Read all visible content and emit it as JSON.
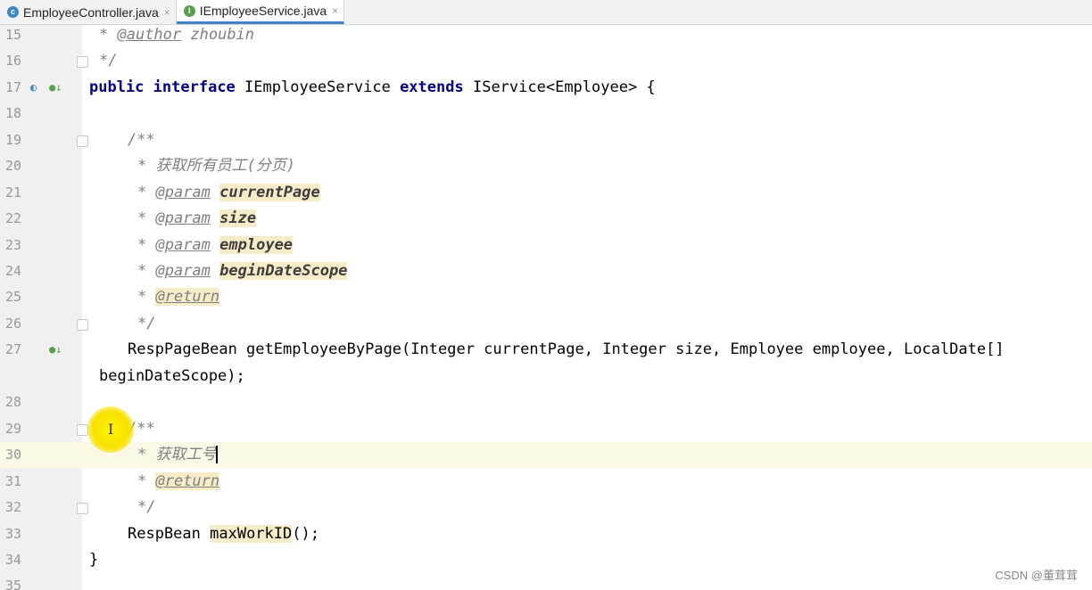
{
  "tabs": [
    {
      "label": "EmployeeController.java",
      "icon": "class-icon",
      "active": false
    },
    {
      "label": "IEmployeeService.java",
      "icon": "interface-icon",
      "active": true
    }
  ],
  "close_glyph": "×",
  "lines": {
    "l15": {
      "num": "15",
      "star": "* ",
      "tag": "@author",
      "rest": " zhoubin"
    },
    "l16": {
      "num": "16",
      "text": "*/"
    },
    "l17": {
      "num": "17",
      "kw1": "public",
      "kw2": "interface",
      "name": "IEmployeeService",
      "kw3": "extends",
      "rest": "IService<Employee> {"
    },
    "l18": {
      "num": "18"
    },
    "l19": {
      "num": "19",
      "text": "/**"
    },
    "l20": {
      "num": "20",
      "text": "* 获取所有员工(分页)"
    },
    "l21": {
      "num": "21",
      "star": "* ",
      "tag": "@param",
      "param": "currentPage"
    },
    "l22": {
      "num": "22",
      "star": "* ",
      "tag": "@param",
      "param": "size"
    },
    "l23": {
      "num": "23",
      "star": "* ",
      "tag": "@param",
      "param": "employee"
    },
    "l24": {
      "num": "24",
      "star": "* ",
      "tag": "@param",
      "param": "beginDateScope"
    },
    "l25": {
      "num": "25",
      "star": "* ",
      "tag": "@return"
    },
    "l26": {
      "num": "26",
      "text": "*/"
    },
    "l27": {
      "num": "27",
      "text": "RespPageBean getEmployeeByPage(Integer currentPage, Integer size, Employee employee, LocalDate[]"
    },
    "l27b": {
      "text": "beginDateScope);"
    },
    "l28": {
      "num": "28"
    },
    "l29": {
      "num": "29",
      "text": "/**"
    },
    "l30": {
      "num": "30",
      "text": "* 获取工号"
    },
    "l31": {
      "num": "31",
      "star": "* ",
      "tag": "@return"
    },
    "l32": {
      "num": "32",
      "text": "*/"
    },
    "l33": {
      "num": "33",
      "type": "RespBean ",
      "method": "maxWorkID",
      "rest": "();"
    },
    "l34": {
      "num": "34",
      "text": "}"
    },
    "l35": {
      "num": "35"
    }
  },
  "watermark": "CSDN @董茸茸",
  "colors": {
    "keyword": "#000080",
    "comment": "#808080",
    "highlight": "#f7ecc8",
    "current_line": "#fbf9e5",
    "tab_underline": "#4083c9"
  }
}
